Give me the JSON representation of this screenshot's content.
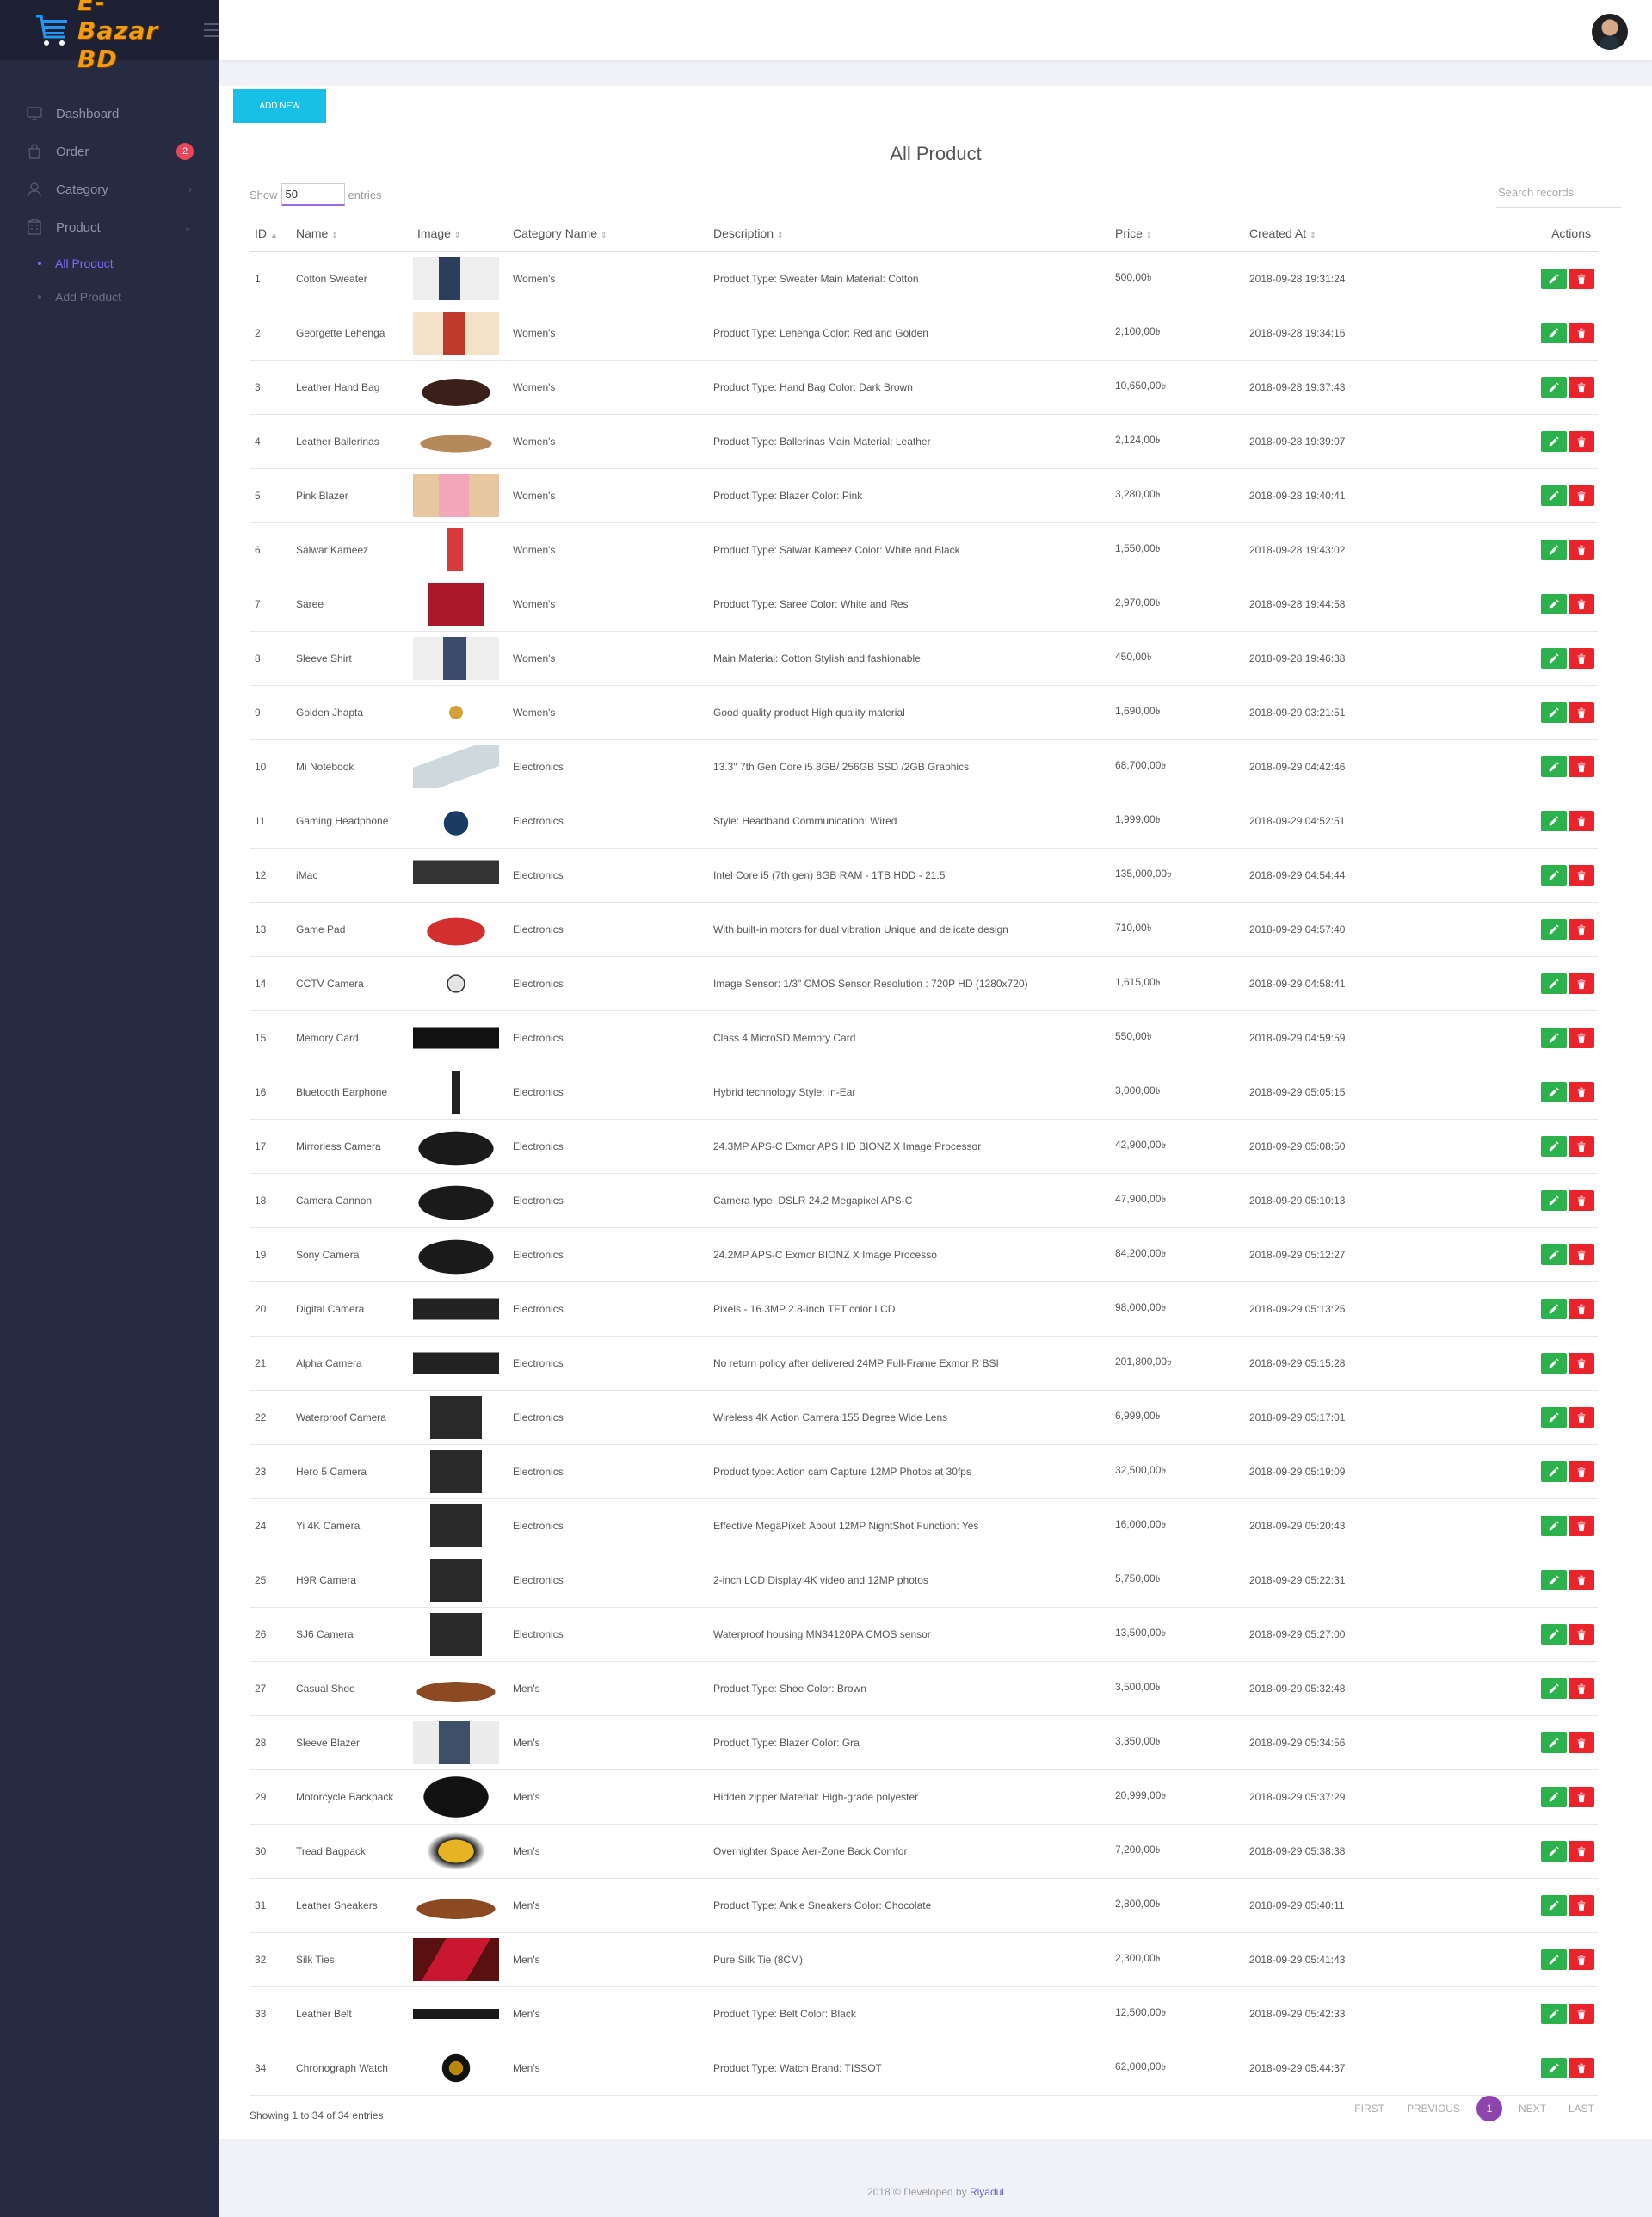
{
  "brand": {
    "name": "E-Bazar BD"
  },
  "sidebar": {
    "items": [
      {
        "label": "Dashboard",
        "icon": "monitor-icon"
      },
      {
        "label": "Order",
        "icon": "shopping-bag-icon",
        "badge": "2"
      },
      {
        "label": "Category",
        "icon": "user-icon"
      },
      {
        "label": "Product",
        "icon": "building-icon"
      }
    ],
    "sub_items": [
      {
        "label": "All Product",
        "active": true
      },
      {
        "label": "Add Product",
        "active": false
      }
    ]
  },
  "main": {
    "add_button": "ADD NEW",
    "title": "All Product",
    "show_label": "Show",
    "show_value": "50",
    "entries_label": "entries",
    "search_placeholder": "Search records",
    "columns": [
      "ID",
      "Name",
      "Image",
      "Category Name",
      "Description",
      "Price",
      "Created At",
      "Actions"
    ],
    "rows": [
      {
        "id": "1",
        "name": "Cotton Sweater",
        "image": "sweater",
        "category": "Women's",
        "description": "Product Type: Sweater Main Material: Cotton",
        "price": "500,00৳",
        "created": "2018-09-28 19:31:24"
      },
      {
        "id": "2",
        "name": "Georgette Lehenga",
        "image": "lehenga",
        "category": "Women's",
        "description": "Product Type: Lehenga Color: Red and Golden",
        "price": "2,100,00৳",
        "created": "2018-09-28 19:34:16"
      },
      {
        "id": "3",
        "name": "Leather Hand Bag",
        "image": "handbag",
        "category": "Women's",
        "description": "Product Type: Hand Bag Color: Dark Brown",
        "price": "10,650,00৳",
        "created": "2018-09-28 19:37:43"
      },
      {
        "id": "4",
        "name": "Leather Ballerinas",
        "image": "ballerinas",
        "category": "Women's",
        "description": "Product Type: Ballerinas Main Material: Leather",
        "price": "2,124,00৳",
        "created": "2018-09-28 19:39:07"
      },
      {
        "id": "5",
        "name": "Pink Blazer",
        "image": "blazer",
        "category": "Women's",
        "description": "Product Type: Blazer Color: Pink",
        "price": "3,280,00৳",
        "created": "2018-09-28 19:40:41"
      },
      {
        "id": "6",
        "name": "Salwar Kameez",
        "image": "kameez",
        "category": "Women's",
        "description": "Product Type: Salwar Kameez Color: White and Black",
        "price": "1,550,00৳",
        "created": "2018-09-28 19:43:02"
      },
      {
        "id": "7",
        "name": "Saree",
        "image": "saree",
        "category": "Women's",
        "description": "Product Type: Saree Color: White and Res",
        "price": "2,970,00৳",
        "created": "2018-09-28 19:44:58"
      },
      {
        "id": "8",
        "name": "Sleeve Shirt",
        "image": "shirt",
        "category": "Women's",
        "description": "Main Material: Cotton Stylish and fashionable",
        "price": "450,00৳",
        "created": "2018-09-28 19:46:38"
      },
      {
        "id": "9",
        "name": "Golden Jhapta",
        "image": "jhapta",
        "category": "Women's",
        "description": "Good quality product High quality material",
        "price": "1,690,00৳",
        "created": "2018-09-29 03:21:51"
      },
      {
        "id": "10",
        "name": "Mi Notebook",
        "image": "notebook",
        "category": "Electronics",
        "description": "13.3\" 7th Gen Core i5 8GB/ 256GB SSD /2GB Graphics",
        "price": "68,700,00৳",
        "created": "2018-09-29 04:42:46"
      },
      {
        "id": "11",
        "name": "Gaming Headphone",
        "image": "headphone",
        "category": "Electronics",
        "description": "Style: Headband Communication: Wired",
        "price": "1,999,00৳",
        "created": "2018-09-29 04:52:51"
      },
      {
        "id": "12",
        "name": "iMac",
        "image": "imac",
        "category": "Electronics",
        "description": "Intel Core i5 (7th gen) 8GB RAM - 1TB HDD - 21.5",
        "price": "135,000,00৳",
        "created": "2018-09-29 04:54:44"
      },
      {
        "id": "13",
        "name": "Game Pad",
        "image": "gamepad",
        "category": "Electronics",
        "description": "With built-in motors for dual vibration Unique and delicate design",
        "price": "710,00৳",
        "created": "2018-09-29 04:57:40"
      },
      {
        "id": "14",
        "name": "CCTV Camera",
        "image": "cctv",
        "category": "Electronics",
        "description": "Image Sensor: 1/3\" CMOS Sensor Resolution : 720P HD (1280x720)",
        "price": "1,615,00৳",
        "created": "2018-09-29 04:58:41"
      },
      {
        "id": "15",
        "name": "Memory Card",
        "image": "memcard",
        "category": "Electronics",
        "description": "Class 4 MicroSD Memory Card",
        "price": "550,00৳",
        "created": "2018-09-29 04:59:59"
      },
      {
        "id": "16",
        "name": "Bluetooth Earphone",
        "image": "earphone",
        "category": "Electronics",
        "description": "Hybrid technology Style: In-Ear",
        "price": "3,000,00৳",
        "created": "2018-09-29 05:05:15"
      },
      {
        "id": "17",
        "name": "Mirrorless Camera",
        "image": "camera",
        "category": "Electronics",
        "description": "24.3MP APS-C Exmor APS HD BIONZ X Image Processor",
        "price": "42,900,00৳",
        "created": "2018-09-29 05:08:50"
      },
      {
        "id": "18",
        "name": "Camera Cannon",
        "image": "camera",
        "category": "Electronics",
        "description": "Camera type: DSLR 24.2 Megapixel APS-C",
        "price": "47,900,00৳",
        "created": "2018-09-29 05:10:13"
      },
      {
        "id": "19",
        "name": "Sony Camera",
        "image": "camera",
        "category": "Electronics",
        "description": "24.2MP APS-C Exmor BIONZ X Image Processo",
        "price": "84,200,00৳",
        "created": "2018-09-29 05:12:27"
      },
      {
        "id": "20",
        "name": "Digital Camera",
        "image": "compact",
        "category": "Electronics",
        "description": "Pixels - 16.3MP 2.8-inch TFT color LCD",
        "price": "98,000,00৳",
        "created": "2018-09-29 05:13:25"
      },
      {
        "id": "21",
        "name": "Alpha Camera",
        "image": "compact",
        "category": "Electronics",
        "description": "No return policy after delivered 24MP Full-Frame Exmor R BSI",
        "price": "201,800,00৳",
        "created": "2018-09-29 05:15:28"
      },
      {
        "id": "22",
        "name": "Waterproof Camera",
        "image": "action",
        "category": "Electronics",
        "description": "Wireless 4K Action Camera 155 Degree Wide Lens",
        "price": "6,999,00৳",
        "created": "2018-09-29 05:17:01"
      },
      {
        "id": "23",
        "name": "Hero 5 Camera",
        "image": "action",
        "category": "Electronics",
        "description": "Product type: Action cam Capture 12MP Photos at 30fps",
        "price": "32,500,00৳",
        "created": "2018-09-29 05:19:09"
      },
      {
        "id": "24",
        "name": "Yi 4K Camera",
        "image": "action",
        "category": "Electronics",
        "description": "Effective MegaPixel: About 12MP NightShot Function: Yes",
        "price": "16,000,00৳",
        "created": "2018-09-29 05:20:43"
      },
      {
        "id": "25",
        "name": "H9R Camera",
        "image": "action",
        "category": "Electronics",
        "description": "2-inch LCD Display 4K video and 12MP photos",
        "price": "5,750,00৳",
        "created": "2018-09-29 05:22:31"
      },
      {
        "id": "26",
        "name": "SJ6 Camera",
        "image": "action",
        "category": "Electronics",
        "description": "Waterproof housing MN34120PA CMOS sensor",
        "price": "13,500,00৳",
        "created": "2018-09-29 05:27:00"
      },
      {
        "id": "27",
        "name": "Casual Shoe",
        "image": "shoe",
        "category": "Men's",
        "description": "Product Type: Shoe Color: Brown",
        "price": "3,500,00৳",
        "created": "2018-09-29 05:32:48"
      },
      {
        "id": "28",
        "name": "Sleeve Blazer",
        "image": "menblazer",
        "category": "Men's",
        "description": "Product Type: Blazer Color: Gra",
        "price": "3,350,00৳",
        "created": "2018-09-29 05:34:56"
      },
      {
        "id": "29",
        "name": "Motorcycle Backpack",
        "image": "backpack",
        "category": "Men's",
        "description": "Hidden zipper Material: High-grade polyester",
        "price": "20,999,00৳",
        "created": "2018-09-29 05:37:29"
      },
      {
        "id": "30",
        "name": "Tread Bagpack",
        "image": "bagpack",
        "category": "Men's",
        "description": "Overnighter Space Aer-Zone Back Comfor",
        "price": "7,200,00৳",
        "created": "2018-09-29 05:38:38"
      },
      {
        "id": "31",
        "name": "Leather Sneakers",
        "image": "shoe",
        "category": "Men's",
        "description": "Product Type: Ankle Sneakers Color: Chocolate",
        "price": "2,800,00৳",
        "created": "2018-09-29 05:40:11"
      },
      {
        "id": "32",
        "name": "Silk Ties",
        "image": "tie",
        "category": "Men's",
        "description": "Pure Silk Tie (8CM)",
        "price": "2,300,00৳",
        "created": "2018-09-29 05:41:43"
      },
      {
        "id": "33",
        "name": "Leather Belt",
        "image": "belt",
        "category": "Men's",
        "description": "Product Type: Belt Color: Black",
        "price": "12,500,00৳",
        "created": "2018-09-29 05:42:33"
      },
      {
        "id": "34",
        "name": "Chronograph Watch",
        "image": "watch",
        "category": "Men's",
        "description": "Product Type: Watch Brand: TISSOT",
        "price": "62,000,00৳",
        "created": "2018-09-29 05:44:37"
      }
    ],
    "showing_text": "Showing 1 to 34 of 34 entries",
    "pagination": {
      "first": "FIRST",
      "previous": "PREVIOUS",
      "current": "1",
      "next": "NEXT",
      "last": "LAST"
    }
  },
  "footer": {
    "text": "2018 © Developed by",
    "author": "Riyadul"
  },
  "colors": {
    "sidebar": "#272b41",
    "accent": "#18bfe6",
    "edit": "#2bb24c",
    "delete": "#e9242b",
    "badge": "#e9455b",
    "active": "#7b6cf6",
    "page_current": "#8e44ad"
  }
}
